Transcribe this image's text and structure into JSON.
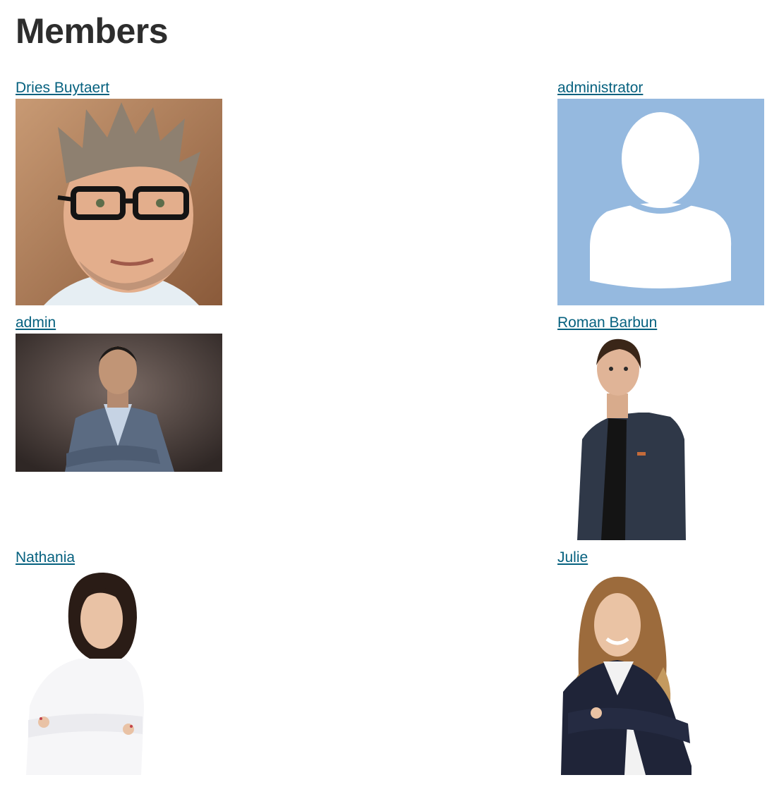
{
  "page": {
    "title": "Members"
  },
  "members": [
    {
      "name": "Dries Buytaert",
      "avatar": "person-photo-icon"
    },
    {
      "name": "administrator",
      "avatar": "default-avatar-icon"
    },
    {
      "name": "admin",
      "avatar": "person-photo-icon"
    },
    {
      "name": "Roman Barbun",
      "avatar": "person-photo-icon"
    },
    {
      "name": "Nathania",
      "avatar": "person-photo-icon"
    },
    {
      "name": "Julie",
      "avatar": "person-photo-icon"
    }
  ],
  "colors": {
    "link": "#06617f",
    "title": "#2d2d2d",
    "default_avatar_bg": "#95b9df"
  }
}
